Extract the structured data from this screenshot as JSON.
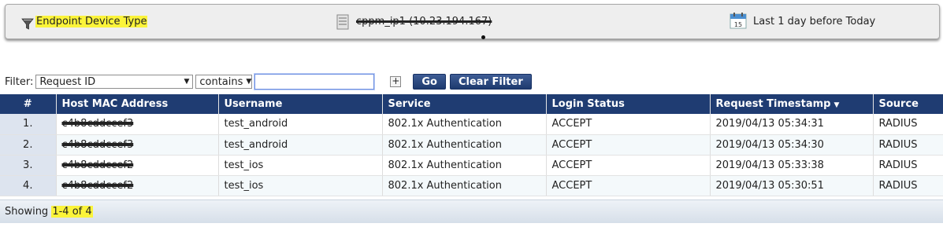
{
  "summary": {
    "filter_label": "Endpoint Device Type",
    "server_label": "cppm_ip1 (10.23.194.167)",
    "date_label": "Last 1 day before Today",
    "calendar_day": "15"
  },
  "filter": {
    "label": "Filter:",
    "field": "Request ID",
    "operator": "contains",
    "value": "",
    "add_label": "+",
    "go_label": "Go",
    "clear_label": "Clear Filter"
  },
  "table": {
    "columns": [
      "#",
      "Host MAC Address",
      "Username",
      "Service",
      "Login Status",
      "Request Timestamp",
      "Source"
    ],
    "sort_indicator": "▼",
    "rows": [
      {
        "num": "1.",
        "mac": "c4b8cddccef3",
        "username": "test_android",
        "service": "802.1x Authentication",
        "status": "ACCEPT",
        "timestamp": "2019/04/13 05:34:31",
        "source": "RADIUS"
      },
      {
        "num": "2.",
        "mac": "c4b8cddccef3",
        "username": "test_android",
        "service": "802.1x Authentication",
        "status": "ACCEPT",
        "timestamp": "2019/04/13 05:34:30",
        "source": "RADIUS"
      },
      {
        "num": "3.",
        "mac": "c4b8cddccef2",
        "username": "test_ios",
        "service": "802.1x Authentication",
        "status": "ACCEPT",
        "timestamp": "2019/04/13 05:33:38",
        "source": "RADIUS"
      },
      {
        "num": "4.",
        "mac": "c4b8cddccef2",
        "username": "test_ios",
        "service": "802.1x Authentication",
        "status": "ACCEPT",
        "timestamp": "2019/04/13 05:30:51",
        "source": "RADIUS"
      }
    ]
  },
  "footer": {
    "showing_label": "Showing",
    "range": "1-4 of 4"
  },
  "colors": {
    "header_bg": "#1f3c72",
    "highlight": "#fbf43a",
    "button_bg": "#2a4a84"
  }
}
